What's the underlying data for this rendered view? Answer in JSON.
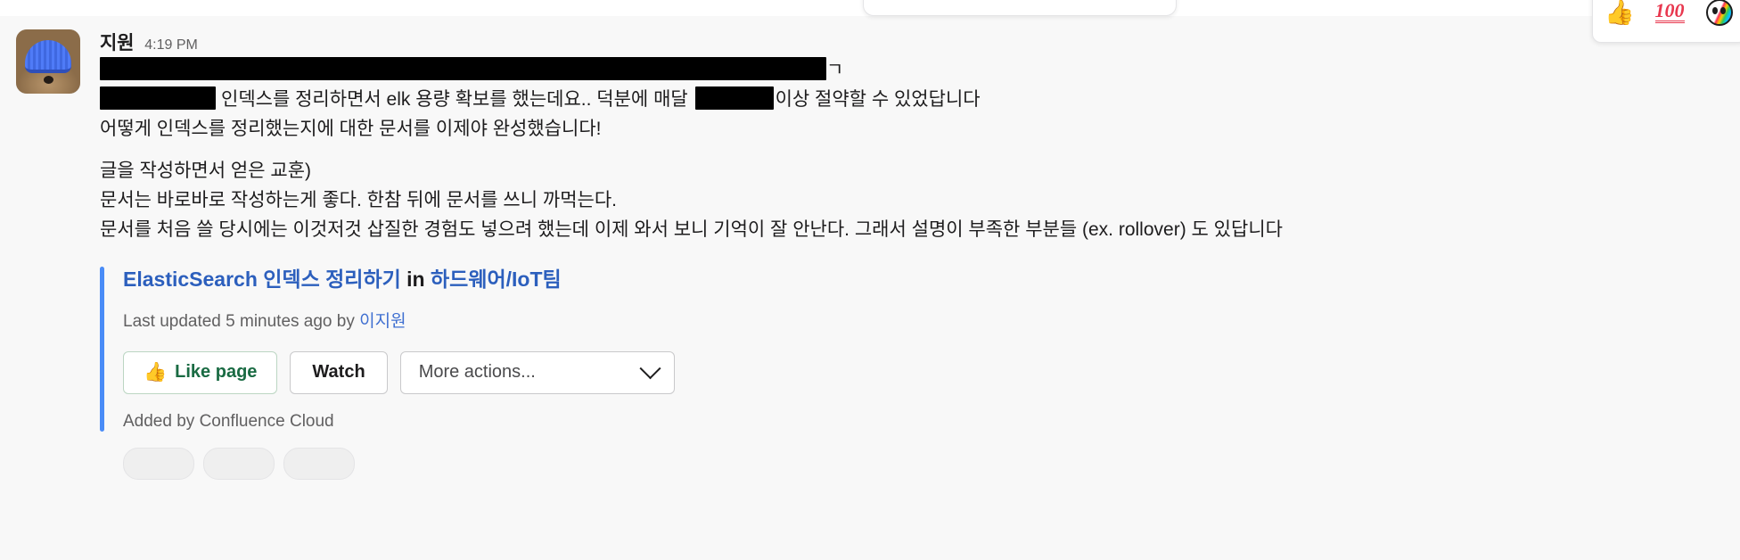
{
  "app": "slack-message-thread",
  "hover_toolbar": {
    "name": "quick-reaction-toolbar",
    "emojis": [
      {
        "name": "thumbsup-emoji",
        "glyph": "👍",
        "label": "thumbs up"
      },
      {
        "name": "hundred-points-emoji",
        "glyph": "100",
        "label": "hundred points"
      },
      {
        "name": "party-face-emoji",
        "glyph": "🥳",
        "label": "partying face"
      }
    ]
  },
  "message": {
    "author": "지원",
    "timestamp": "4:19 PM",
    "avatar_alt": "dog wearing blue beanie",
    "lines": [
      {
        "type": "redacted",
        "redactions": [
          "wide"
        ],
        "trailing_text": "ㄱ"
      },
      {
        "type": "mixed",
        "prefix_redaction": "small",
        "text_after": "인덱스를 정리하면서 elk 용량 확보를 했는데요.. 덕분에 매달 ",
        "inline_redaction": "mid",
        "text_end": "이상 절약할 수 있었답니다"
      },
      {
        "type": "text",
        "text": "어떻게 인덱스를 정리했는지에 대한 문서를 이제야 완성했습니다!"
      },
      {
        "type": "blank",
        "text": ""
      },
      {
        "type": "text",
        "text": "글을 작성하면서 얻은 교훈)"
      },
      {
        "type": "text",
        "text": "문서는 바로바로 작성하는게 좋다. 한참 뒤에 문서를 쓰니 까먹는다."
      },
      {
        "type": "text",
        "text": "문서를 처음 쓸 당시에는 이것저것 삽질한 경험도 넣으려 했는데 이제 와서 보니 기억이 잘 안난다. 그래서 설명이 부족한 부분들 (ex. rollover) 도 있답니다"
      }
    ]
  },
  "unfurl": {
    "accent_color": "#4a8cf7",
    "title_link": "ElasticSearch 인덱스 정리하기",
    "title_separator": "in",
    "space_link": "하드웨어/IoT팀",
    "meta_prefix": "Last updated 5 minutes ago by",
    "meta_user": "이지원",
    "buttons": {
      "like": {
        "label": "Like page",
        "icon": "👍",
        "icon_name": "thumbsup-icon"
      },
      "watch": {
        "label": "Watch"
      },
      "more_actions": {
        "label": "More actions...",
        "chevron_name": "chevron-down-icon"
      }
    },
    "footer": "Added by Confluence Cloud"
  },
  "reactions": [
    {
      "name": "reaction-pill-1"
    },
    {
      "name": "reaction-pill-2"
    },
    {
      "name": "reaction-pill-3"
    }
  ],
  "colors": {
    "page_background": "#f8f8f8",
    "text_primary": "#1d1c1d",
    "text_secondary": "#616061",
    "link_blue": "#2c5fbd",
    "accent_blue": "#4a8cf7",
    "like_green": "#1a6b43"
  }
}
